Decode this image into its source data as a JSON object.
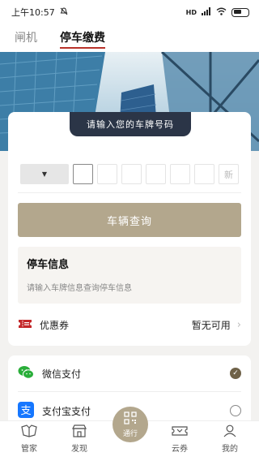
{
  "status_bar": {
    "time": "上午10:57",
    "signal": "HD"
  },
  "tabs": [
    {
      "label": "闸机",
      "active": false
    },
    {
      "label": "停车缴费",
      "active": true
    }
  ],
  "plate": {
    "prompt": "请输入您的车牌号码",
    "province_value": "",
    "new_energy_label": "新"
  },
  "query_button": "车辆查询",
  "parking_info": {
    "title": "停车信息",
    "placeholder": "请输入车牌信息查询停车信息"
  },
  "coupon": {
    "label": "优惠券",
    "value": "暂无可用"
  },
  "payment": [
    {
      "label": "微信支付",
      "selected": true
    },
    {
      "label": "支付宝支付",
      "selected": false
    }
  ],
  "nav": {
    "home": "管家",
    "discover": "发现",
    "pass": "通行",
    "coupons": "云券",
    "mine": "我的"
  },
  "colors": {
    "accent": "#b3a78d",
    "tab_underline": "#b8322a",
    "tip_bg": "#2b3547"
  }
}
